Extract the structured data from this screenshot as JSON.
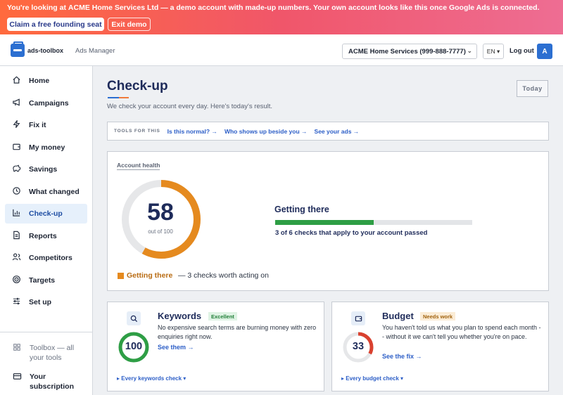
{
  "banner": {
    "prefix": "You're looking at ",
    "account_name": "ACME Home Services Ltd",
    "suffix": " — a demo account with made-up numbers. Your own account looks like this once Google Ads is connected.",
    "claim_label": "Claim a free founding seat",
    "exit_label": "Exit demo"
  },
  "header": {
    "logo_text": "ads-toolbox",
    "subtitle": "Ads Manager",
    "account_selector": "ACME Home Services (999-888-7777)",
    "language": "EN ▾",
    "logout_label": "Log out",
    "avatar_initial": "A"
  },
  "sidebar": {
    "items": [
      {
        "label": "Home",
        "icon": "home-icon"
      },
      {
        "label": "Campaigns",
        "icon": "megaphone-icon"
      },
      {
        "label": "Fix it",
        "icon": "lightning-icon"
      },
      {
        "label": "My money",
        "icon": "wallet-icon"
      },
      {
        "label": "Savings",
        "icon": "piggy-bank-icon"
      },
      {
        "label": "What changed",
        "icon": "history-icon"
      },
      {
        "label": "Check-up",
        "icon": "bar-chart-icon"
      },
      {
        "label": "Reports",
        "icon": "document-icon"
      },
      {
        "label": "Competitors",
        "icon": "people-icon"
      },
      {
        "label": "Targets",
        "icon": "target-icon"
      },
      {
        "label": "Set up",
        "icon": "sliders-icon"
      }
    ],
    "active": "Check-up",
    "toolbox_label": "Toolbox — all your tools",
    "subscription_label": "Your subscription"
  },
  "page": {
    "title": "Check-up",
    "subtitle": "We check your account every day. Here's today's result.",
    "today_button": "Today"
  },
  "tools": {
    "label": "TOOLS FOR THIS",
    "links": [
      "Is this normal? →",
      "Who shows up beside you →",
      "See your ads →"
    ]
  },
  "health": {
    "label": "Account health",
    "score": "58",
    "score_fraction": 0.58,
    "out_of": "out of 100",
    "status_title": "Getting there",
    "checks_passed_fraction": 0.5,
    "checks_text": "3 of 6 checks that apply to your account passed",
    "legend_label": "Getting there",
    "legend_note": "— 3 checks worth acting on",
    "colors": {
      "score": "#e58a1f",
      "track": "#e6e7e9",
      "progress": "#2e9e45"
    }
  },
  "cards": {
    "keywords": {
      "icon": "search-icon",
      "title": "Keywords",
      "badge": "Excellent",
      "description": "No expensive search terms are burning money with zero enquiries right now.",
      "link": "See them →",
      "score": "100",
      "score_fraction": 1.0,
      "more": "▸ Every keywords check ▾",
      "color": "#2e9e45"
    },
    "budget": {
      "icon": "wallet-icon",
      "title": "Budget",
      "badge": "Needs work",
      "description": "You haven't told us what you plan to spend each month -- without it we can't tell you whether you're on pace.",
      "link": "See the fix →",
      "score": "33",
      "score_fraction": 0.33,
      "more": "▸ Every budget check ▾",
      "color": "#d9412f"
    }
  }
}
